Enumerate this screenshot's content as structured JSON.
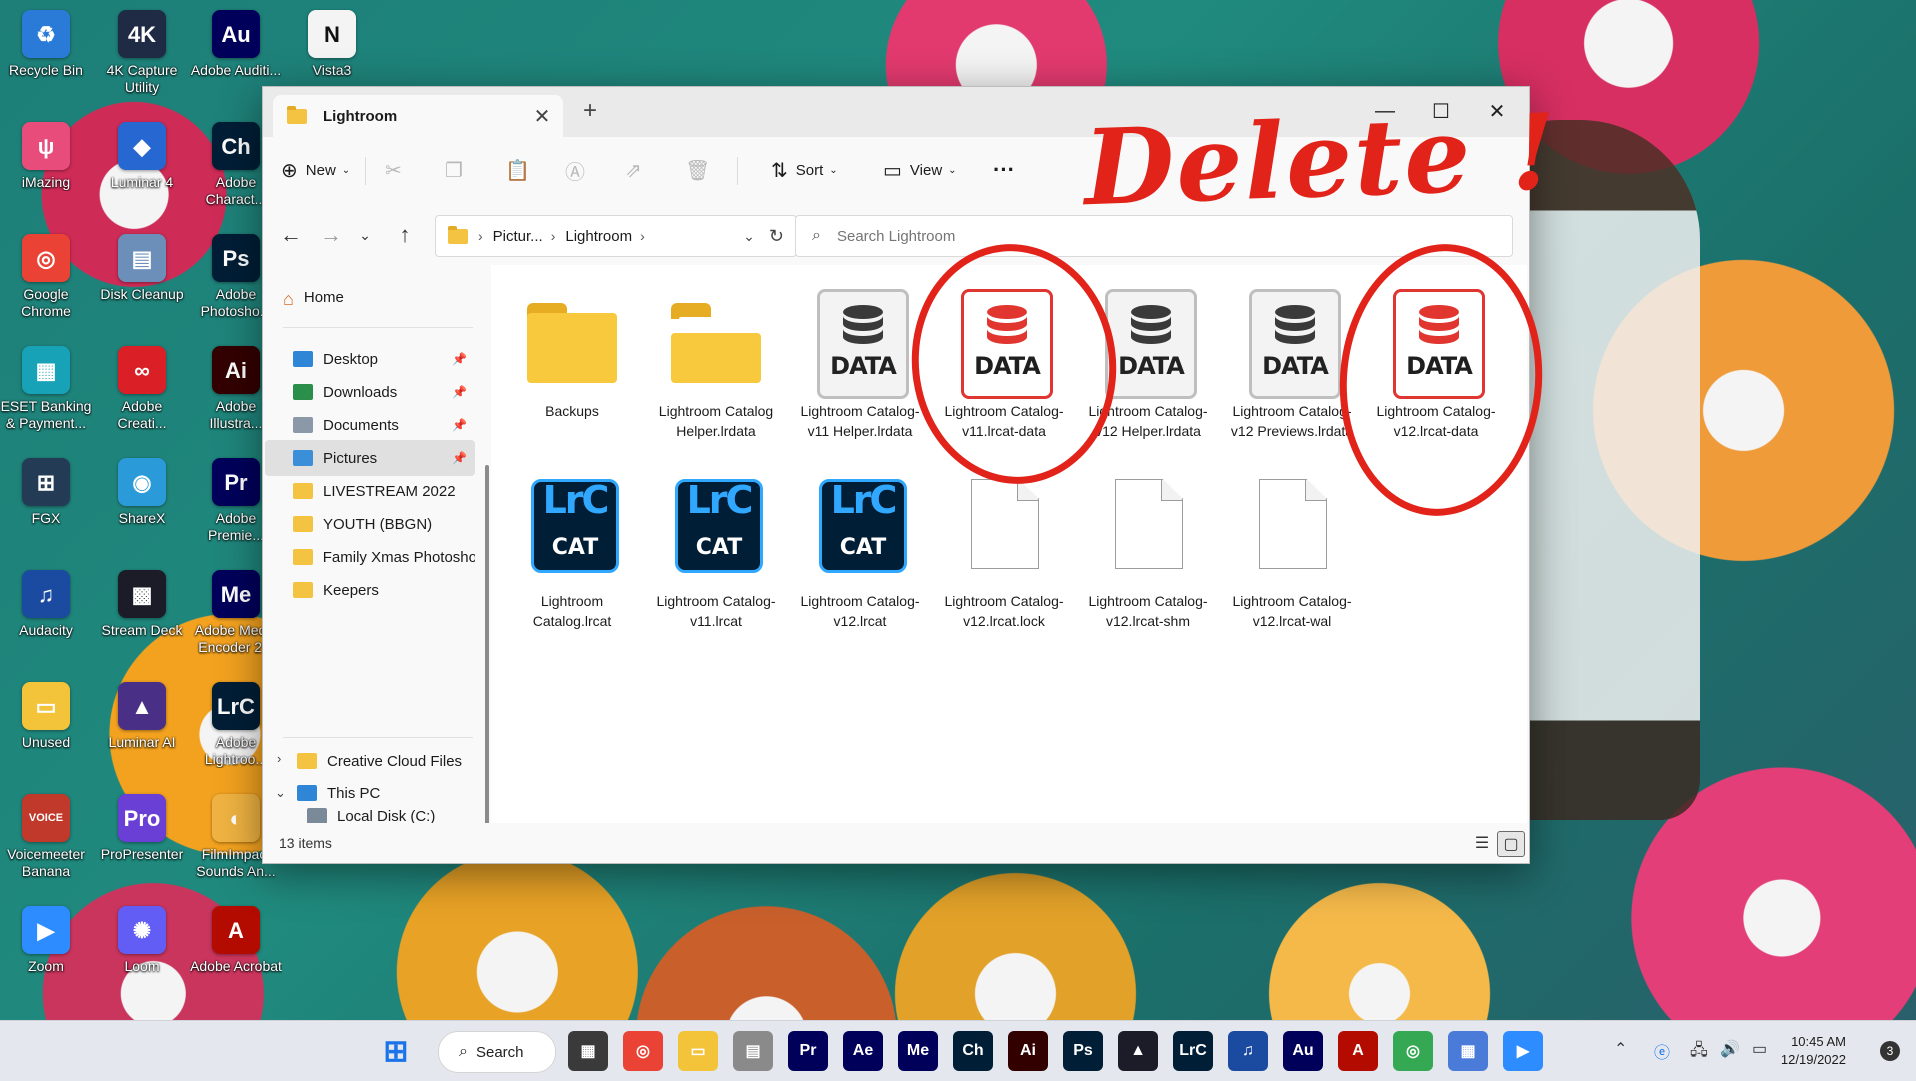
{
  "desktop": {
    "icons": [
      {
        "label": "Recycle Bin",
        "glyph": "♻",
        "color": "#2a7bd8"
      },
      {
        "label": "4K Capture Utility",
        "glyph": "4K",
        "color": "#1f2a44"
      },
      {
        "label": "Adobe Auditi...",
        "glyph": "Au",
        "color": "#00005b"
      },
      {
        "label": "Vista3",
        "glyph": "N",
        "color": "#f4f4f4"
      },
      {
        "label": "iMazing",
        "glyph": "ψ",
        "color": "#e84c7a"
      },
      {
        "label": "Luminar 4",
        "glyph": "◆",
        "color": "#2767d1"
      },
      {
        "label": "Adobe Charact...",
        "glyph": "Ch",
        "color": "#001e36"
      },
      {
        "label": "Google Chrome",
        "glyph": "◎",
        "color": "#ea4335"
      },
      {
        "label": "Disk Cleanup",
        "glyph": "▤",
        "color": "#6b8fb8"
      },
      {
        "label": "Adobe Photosho...",
        "glyph": "Ps",
        "color": "#001e36"
      },
      {
        "label": "ESET Banking & Payment...",
        "glyph": "▦",
        "color": "#17a2b8"
      },
      {
        "label": "Adobe Creati...",
        "glyph": "∞",
        "color": "#da1f26"
      },
      {
        "label": "Adobe Illustra...",
        "glyph": "Ai",
        "color": "#330000"
      },
      {
        "label": "FGX",
        "glyph": "⊞",
        "color": "#243b55"
      },
      {
        "label": "ShareX",
        "glyph": "◉",
        "color": "#2b9ad8"
      },
      {
        "label": "Adobe Premie...",
        "glyph": "Pr",
        "color": "#00005b"
      },
      {
        "label": "Audacity",
        "glyph": "♫",
        "color": "#1b4ba0"
      },
      {
        "label": "Stream Deck",
        "glyph": "▩",
        "color": "#1c1c28"
      },
      {
        "label": "Adobe Media Encoder 2...",
        "glyph": "Me",
        "color": "#00005b"
      },
      {
        "label": "Unused",
        "glyph": "▭",
        "color": "#f3c33a"
      },
      {
        "label": "Luminar AI",
        "glyph": "▲",
        "color": "#4a2f86"
      },
      {
        "label": "Adobe Lightroo...",
        "glyph": "LrC",
        "color": "#001e36"
      },
      {
        "label": "Voicemeeter Banana",
        "glyph": "VOICE",
        "color": "#c0392b"
      },
      {
        "label": "ProPresenter",
        "glyph": "Pro",
        "color": "#6a3fd6"
      },
      {
        "label": "FilmImpact Sounds An...",
        "glyph": "◐",
        "color": "#f0b342"
      },
      {
        "label": "Zoom",
        "glyph": "▶",
        "color": "#2d8cff"
      },
      {
        "label": "Loom",
        "glyph": "✺",
        "color": "#625df5"
      },
      {
        "label": "Adobe Acrobat",
        "glyph": "A",
        "color": "#b30b00"
      }
    ]
  },
  "window": {
    "tab_title": "Lightroom",
    "tab_close": "✕",
    "tab_add": "+",
    "controls": {
      "minimize": "—",
      "maximize": "☐",
      "close": "✕"
    }
  },
  "commandbar": {
    "new_label": "New",
    "sort_label": "Sort",
    "view_label": "View",
    "more": "···"
  },
  "address": {
    "crumbs": [
      "Pictur...",
      "Lightroom"
    ],
    "search_placeholder": "Search Lightroom"
  },
  "sidebar": {
    "home": "Home",
    "quick": [
      {
        "label": "Desktop",
        "pinned": true
      },
      {
        "label": "Downloads",
        "pinned": true
      },
      {
        "label": "Documents",
        "pinned": true
      },
      {
        "label": "Pictures",
        "pinned": true,
        "selected": true
      },
      {
        "label": "LIVESTREAM 2022",
        "pinned": false
      },
      {
        "label": "YOUTH (BBGN)",
        "pinned": false
      },
      {
        "label": "Family Xmas Photosho",
        "pinned": false
      },
      {
        "label": "Keepers",
        "pinned": false
      }
    ],
    "creative_cloud": "Creative Cloud Files",
    "this_pc": "This PC",
    "local_disk": "Local Disk (C:)"
  },
  "files": [
    {
      "type": "folder",
      "name": "Backups"
    },
    {
      "type": "folder-doc",
      "name": "Lightroom Catalog Helper.lrdata"
    },
    {
      "type": "data",
      "name": "Lightroom Catalog-v11 Helper.lrdata",
      "icon_text": "DATA"
    },
    {
      "type": "data-red",
      "name": "Lightroom Catalog-v11.lrcat-data",
      "icon_text": "DATA"
    },
    {
      "type": "data",
      "name": "Lightroom Catalog-v12 Helper.lrdata",
      "icon_text": "DATA"
    },
    {
      "type": "data",
      "name": "Lightroom Catalog-v12 Previews.lrdata",
      "icon_text": "DATA"
    },
    {
      "type": "data-red",
      "name": "Lightroom Catalog-v12.lrcat-data",
      "icon_text": "DATA"
    },
    {
      "type": "lrcat",
      "name": "Lightroom Catalog.lrcat",
      "icon_top": "LrC",
      "icon_bottom": "CAT"
    },
    {
      "type": "lrcat",
      "name": "Lightroom Catalog-v11.lrcat",
      "icon_top": "LrC",
      "icon_bottom": "CAT"
    },
    {
      "type": "lrcat",
      "name": "Lightroom Catalog-v12.lrcat",
      "icon_top": "LrC",
      "icon_bottom": "CAT"
    },
    {
      "type": "blank",
      "name": "Lightroom Catalog-v12.lrcat.lock"
    },
    {
      "type": "blank",
      "name": "Lightroom Catalog-v12.lrcat-shm"
    },
    {
      "type": "blank",
      "name": "Lightroom Catalog-v12.lrcat-wal"
    }
  ],
  "status": {
    "items_count": "13 items"
  },
  "annotation": {
    "text": "Delete !",
    "color": "#e2231a"
  },
  "taskbar": {
    "search_label": "Search",
    "apps": [
      {
        "label": "▦",
        "color": "#3a3a3a"
      },
      {
        "label": "◎",
        "color": "#ea4335"
      },
      {
        "label": "▭",
        "color": "#f3c33a"
      },
      {
        "label": "▤",
        "color": "#8a8a8a"
      },
      {
        "label": "Pr",
        "color": "#00005b"
      },
      {
        "label": "Ae",
        "color": "#00005b"
      },
      {
        "label": "Me",
        "color": "#00005b"
      },
      {
        "label": "Ch",
        "color": "#001e36"
      },
      {
        "label": "Ai",
        "color": "#330000"
      },
      {
        "label": "Ps",
        "color": "#001e36"
      },
      {
        "label": "▲",
        "color": "#1c1c28"
      },
      {
        "label": "LrC",
        "color": "#001e36"
      },
      {
        "label": "♫",
        "color": "#1b4ba0"
      },
      {
        "label": "Au",
        "color": "#00005b"
      },
      {
        "label": "A",
        "color": "#b30b00"
      },
      {
        "label": "◎",
        "color": "#34a853"
      },
      {
        "label": "▦",
        "color": "#4a7bd8"
      },
      {
        "label": "▶",
        "color": "#2d8cff"
      }
    ],
    "time": "10:45 AM",
    "date": "12/19/2022",
    "notifications": "3"
  }
}
